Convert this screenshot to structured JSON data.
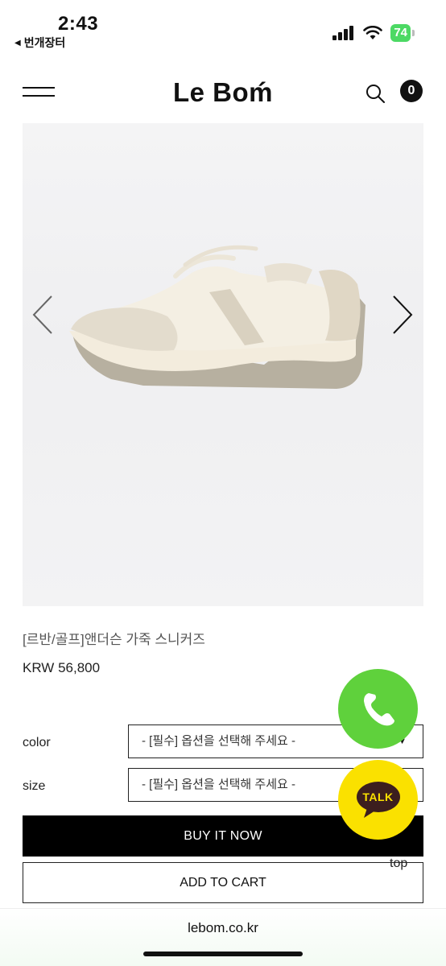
{
  "status_bar": {
    "time": "2:43",
    "back_app": "번개장터",
    "battery": "74"
  },
  "header": {
    "brand": "Le Boḿ",
    "cart_count": "0"
  },
  "product": {
    "name": "[르반/골프]앤더슨 가죽 스니커즈",
    "price": "KRW 56,800"
  },
  "options": [
    {
      "label": "color",
      "placeholder": "- [필수] 옵션을 선택해 주세요 -"
    },
    {
      "label": "size",
      "placeholder": "- [필수] 옵션을 선택해 주세요 -"
    }
  ],
  "actions": {
    "buy_now": "BUY IT NOW",
    "add_to_cart": "ADD TO CART"
  },
  "floating": {
    "kakao_label": "TALK",
    "top_label": "top"
  },
  "browser": {
    "url": "lebom.co.kr"
  },
  "colors": {
    "phone_button": "#5fd13c",
    "kakao_button": "#fae100",
    "buy_button": "#000000"
  }
}
